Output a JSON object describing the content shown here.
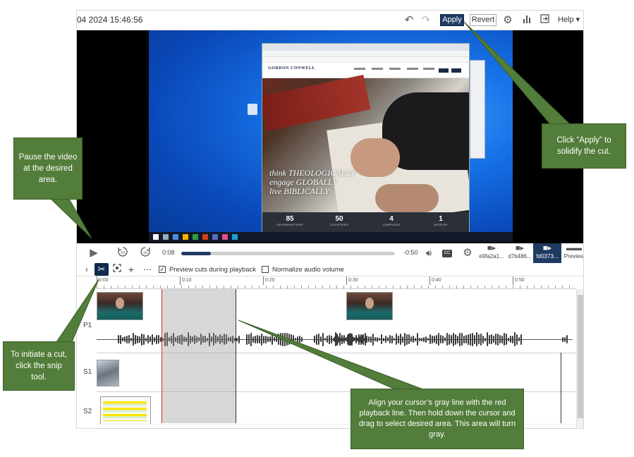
{
  "topbar": {
    "title": "04 2024 15:46:56",
    "apply_label": "Apply",
    "revert_label": "Revert",
    "help_label": "Help"
  },
  "video": {
    "website_logo": "GORDON CONWELL",
    "hero_lines": [
      "think THEOLOGICALLY",
      "engage GLOBALLY",
      "live BIBLICALLY"
    ],
    "stats": [
      {
        "value": "85",
        "label": "DENOMINATIONS"
      },
      {
        "value": "50",
        "label": "COUNTRIES"
      },
      {
        "value": "4",
        "label": "CAMPUSES"
      },
      {
        "value": "1",
        "label": "MISSION"
      }
    ]
  },
  "player": {
    "current_time": "0:08",
    "remaining_time": "-0:50",
    "progress_fraction": 0.14,
    "cc_label": "CC",
    "sources": [
      {
        "label": "e9fa2a1...",
        "active": false
      },
      {
        "label": "d7b486...",
        "active": false
      },
      {
        "label": "fd0373...",
        "active": true
      },
      {
        "label": "Preview",
        "active": false
      }
    ]
  },
  "edit_toolbar": {
    "preview_cuts_label": "Preview cuts during playback",
    "preview_cuts_checked": true,
    "normalize_label": "Normalize audio volume",
    "normalize_checked": false
  },
  "timeline": {
    "ticks": [
      "0:00",
      "0:10",
      "0:20",
      "0:30",
      "0:40",
      "0:50"
    ],
    "tracks": [
      "P1",
      "S1",
      "S2"
    ]
  },
  "annotations": {
    "pause": "Pause the video at the desired area.",
    "apply": "Click “Apply” to solidify the cut.",
    "snip": "To initiate a cut, click the snip tool.",
    "align": "Align your cursor’s gray line with the red playback line.  Then hold down the cursor and drag to select desired area.  This area will turn gray."
  },
  "colors": {
    "accent": "#1f3b62",
    "callout": "#527d3a",
    "playhead": "#d12b2b"
  }
}
